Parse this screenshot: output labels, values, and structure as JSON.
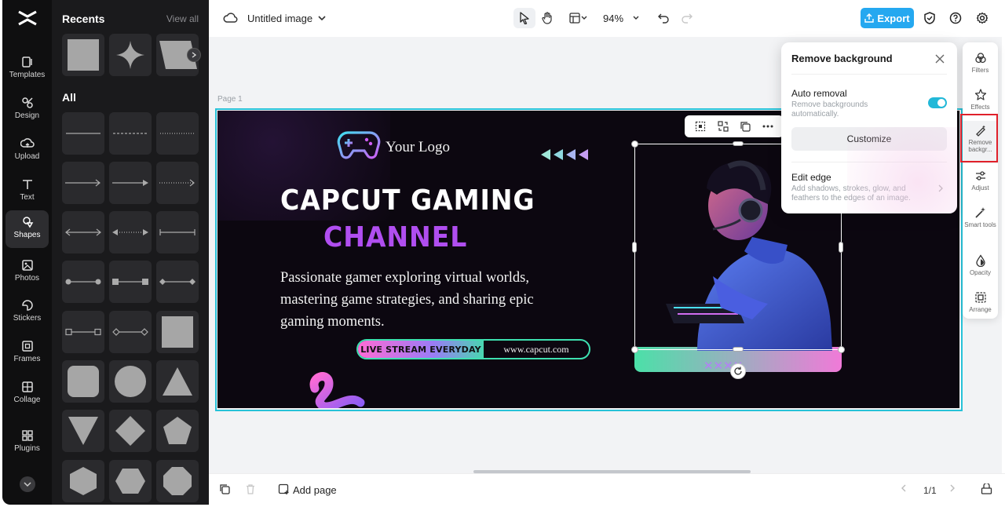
{
  "rail": {
    "items": [
      {
        "label": "Templates",
        "icon": "templates-icon"
      },
      {
        "label": "Design",
        "icon": "design-icon"
      },
      {
        "label": "Upload",
        "icon": "upload-icon"
      },
      {
        "label": "Text",
        "icon": "text-icon"
      },
      {
        "label": "Shapes",
        "icon": "shapes-icon",
        "active": true
      },
      {
        "label": "Photos",
        "icon": "photos-icon"
      },
      {
        "label": "Stickers",
        "icon": "stickers-icon"
      },
      {
        "label": "Frames",
        "icon": "frames-icon"
      },
      {
        "label": "Collage",
        "icon": "collage-icon"
      },
      {
        "label": "Plugins",
        "icon": "plugins-icon"
      }
    ]
  },
  "panel": {
    "recents_title": "Recents",
    "view_all": "View all",
    "all_title": "All"
  },
  "topbar": {
    "doc_title": "Untitled image",
    "zoom": "94%",
    "export_label": "Export"
  },
  "canvas": {
    "page_label": "Page 1"
  },
  "design": {
    "logo_text": "Your Logo",
    "title_line1": "CAPCUT GAMING",
    "title_line2": "CHANNEL",
    "description": "Passionate gamer exploring virtual worlds, mastering game strategies, and sharing epic gaming moments.",
    "pill_left": "LIVE STREAM EVERYDAY",
    "pill_right": "www.capcut.com",
    "colors": {
      "background": "#0c0710",
      "accent_purple": "#b04ef0",
      "accent_teal": "#3ee0b0",
      "accent_pink": "#ff6bd5"
    }
  },
  "remove_bg": {
    "title": "Remove background",
    "auto_label": "Auto removal",
    "auto_desc": "Remove backgrounds automatically.",
    "auto_on": true,
    "customize_label": "Customize",
    "edge_label": "Edit edge",
    "edge_desc": "Add shadows, strokes, glow, and feathers to the edges of an image."
  },
  "right_rail": {
    "filters": "Filters",
    "effects": "Effects",
    "remove_bg": "Remove backgr...",
    "adjust": "Adjust",
    "smart_tools": "Smart tools",
    "opacity": "Opacity",
    "arrange": "Arrange"
  },
  "bottombar": {
    "add_page": "Add page",
    "pages": "1/1"
  },
  "theme": {
    "export_blue": "#25a8f0",
    "selection_cyan": "#27c2d8",
    "highlight_red": "#e0202a"
  }
}
